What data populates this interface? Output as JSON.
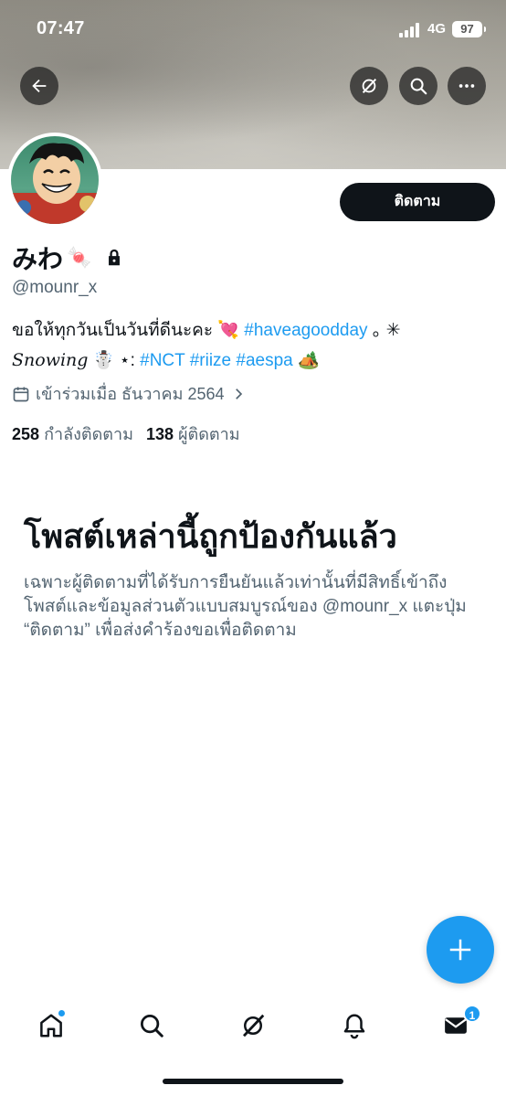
{
  "status_bar": {
    "time": "07:47",
    "network": "4G",
    "battery": "97"
  },
  "profile": {
    "display_name": "みわ",
    "name_emoji": "🍬",
    "handle": "@mounr_x",
    "follow_label": "ติดตาม",
    "bio": {
      "line1_text": "ขอให้ทุกวันเป็นวันที่ดีนะคะ ",
      "line1_emoji": "💘",
      "line1_tag": "#haveagoodday",
      "line1_tail": " ｡ ✳",
      "line2_word": "Snowing",
      "line2_emoji": "☃️",
      "line2_sep": "⋆:",
      "tags": [
        "#NCT",
        "#riize",
        "#aespa"
      ],
      "line2_end_emoji": "🏕️"
    },
    "joined": "เข้าร่วมเมื่อ ธันวาคม 2564",
    "following_count": "258",
    "following_label": "กำลังติดตาม",
    "followers_count": "138",
    "followers_label": "ผู้ติดตาม"
  },
  "protected": {
    "title": "โพสต์เหล่านี้ถูกป้องกันแล้ว",
    "description": "เฉพาะผู้ติดตามที่ได้รับการยืนยันแล้วเท่านั้นที่มีสิทธิ์เข้าถึง โพสต์และข้อมูลส่วนตัวแบบสมบูรณ์ของ @mounr_x แตะปุ่ม “ติดตาม” เพื่อส่งคำร้องขอเพื่อติดตาม"
  },
  "tabbar": {
    "items": [
      "home-icon",
      "search-icon",
      "grok-icon",
      "notifications-icon",
      "messages-icon"
    ],
    "messages_badge": "1"
  },
  "colors": {
    "accent": "#1d9bf0",
    "text": "#0f1419",
    "muted": "#536471"
  }
}
